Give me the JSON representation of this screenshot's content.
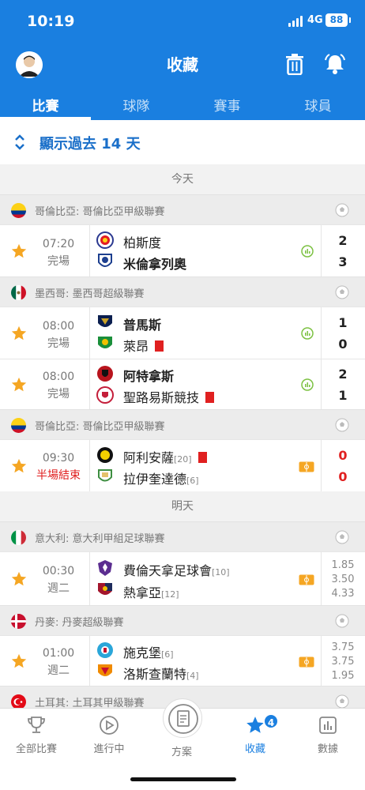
{
  "status": {
    "time": "10:19",
    "network": "4G",
    "battery": "88"
  },
  "header": {
    "title": "收藏",
    "tabs": [
      "比賽",
      "球隊",
      "賽事",
      "球員"
    ],
    "active_tab": 0
  },
  "filter": {
    "label": "顯示過去 14 天"
  },
  "days": {
    "today": "今天",
    "tomorrow": "明天"
  },
  "leagues": [
    {
      "name": "哥倫比亞: 哥倫比亞甲級聯賽",
      "flag": "colombia"
    },
    {
      "name": "墨西哥: 墨西哥超級聯賽",
      "flag": "mexico"
    },
    {
      "name": "哥倫比亞: 哥倫比亞甲級聯賽",
      "flag": "colombia"
    },
    {
      "name": "意大利: 意大利甲組足球聯賽",
      "flag": "italy"
    },
    {
      "name": "丹麥: 丹麥超級聯賽",
      "flag": "denmark"
    },
    {
      "name": "土耳其: 土耳其甲級聯賽",
      "flag": "turkey"
    }
  ],
  "matches": [
    {
      "time": "07:20",
      "status": "完場",
      "home": "柏斯度",
      "away": "米倫拿列奧",
      "home_score": "2",
      "away_score": "3"
    },
    {
      "time": "08:00",
      "status": "完場",
      "home": "普馬斯",
      "away": "萊昂",
      "home_score": "1",
      "away_score": "0"
    },
    {
      "time": "08:00",
      "status": "完場",
      "home": "阿特拿斯",
      "away": "聖路易斯競技",
      "home_score": "2",
      "away_score": "1"
    },
    {
      "time": "09:30",
      "status": "半場結束",
      "home": "阿利安薩",
      "home_rank": "[20]",
      "away": "拉伊奎達德",
      "away_rank": "[6]",
      "home_score": "0",
      "away_score": "0"
    },
    {
      "time": "00:30",
      "status": "週二",
      "home": "費倫天拿足球會",
      "home_rank": "[10]",
      "away": "熱拿亞",
      "away_rank": "[12]",
      "odds": [
        "1.85",
        "3.50",
        "4.33"
      ]
    },
    {
      "time": "01:00",
      "status": "週二",
      "home": "施克堡",
      "home_rank": "[6]",
      "away": "洛斯查蘭特",
      "away_rank": "[4]",
      "odds": [
        "3.75",
        "3.75",
        "1.95"
      ]
    }
  ],
  "bottom_nav": {
    "items": [
      "全部比賽",
      "進行中",
      "方案",
      "收藏",
      "數據"
    ],
    "badge": "4"
  },
  "colors": {
    "primary": "#1a7fe0",
    "live": "#e02020",
    "star": "#f5a623"
  }
}
